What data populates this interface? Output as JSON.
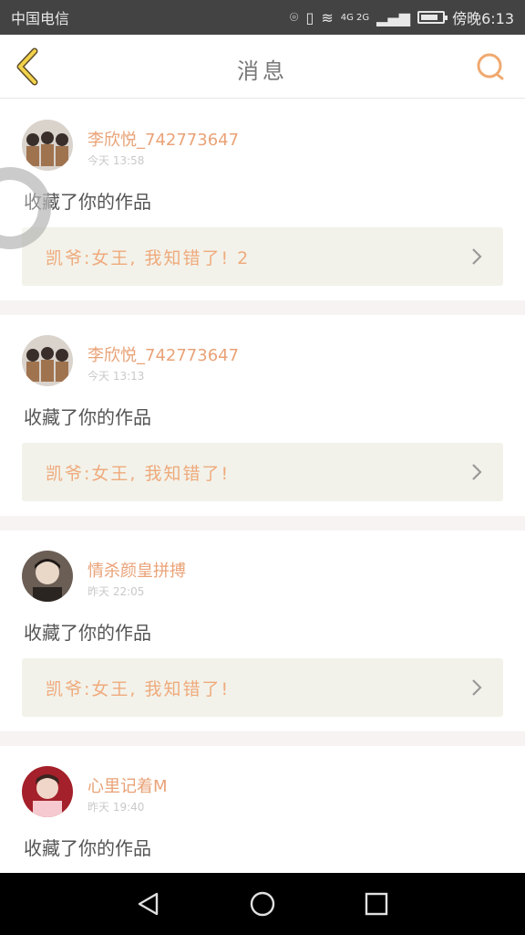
{
  "status_bar": {
    "carrier": "中国电信",
    "time": "傍晚6:13",
    "network": "4G 2G",
    "battery_level": 0.8
  },
  "header": {
    "title": "消息",
    "accent_color": "#f0a96f"
  },
  "messages": [
    {
      "username": "李欣悦_742773647",
      "time": "今天 13:58",
      "action": "收藏了你的作品",
      "work_title": "凯爷:女王, 我知错了! 2"
    },
    {
      "username": "李欣悦_742773647",
      "time": "今天 13:13",
      "action": "收藏了你的作品",
      "work_title": "凯爷:女王, 我知错了!"
    },
    {
      "username": "情杀颜皇拼搏",
      "time": "昨天 22:05",
      "action": "收藏了你的作品",
      "work_title": "凯爷:女王, 我知错了!"
    },
    {
      "username": "心里记着M",
      "time": "昨天 19:40",
      "action": "收藏了你的作品"
    }
  ]
}
